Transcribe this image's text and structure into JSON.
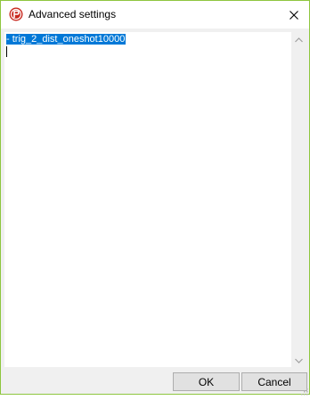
{
  "window": {
    "title": "Advanced settings",
    "icon": "app-logo-icon",
    "border_color": "#8ec63f"
  },
  "titlebar": {
    "close_icon": "close-icon"
  },
  "editor": {
    "selected_text": "- trig_2_dist_oneshot10000",
    "selection_color": "#0078d7"
  },
  "buttons": {
    "ok_label": "OK",
    "cancel_label": "Cancel"
  }
}
